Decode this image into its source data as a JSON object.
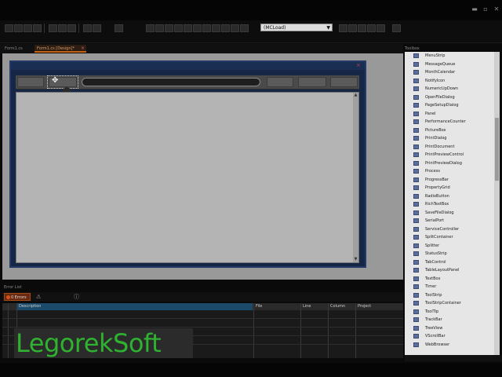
{
  "toolbar": {
    "config_combo": "(MCLoad)"
  },
  "doc_tabs": [
    {
      "label": "Form1.cs"
    },
    {
      "label": "Form1.cs [Design]*",
      "close": "×"
    }
  ],
  "form": {
    "close_glyph": "×",
    "move_glyph": "✥",
    "scroll_up": "▲",
    "scroll_down": "▼"
  },
  "error_list": {
    "header": "Error List",
    "errors_badge": "0 Errors",
    "columns": [
      "Description",
      "File",
      "Line",
      "Column",
      "Project"
    ]
  },
  "watermark": "LegorekSoft",
  "toolbox": {
    "title": "Toolbox",
    "items": [
      "MenuStrip",
      "MessageQueue",
      "MonthCalendar",
      "NotifyIcon",
      "NumericUpDown",
      "OpenFileDialog",
      "PageSetupDialog",
      "Panel",
      "PerformanceCounter",
      "PictureBox",
      "PrintDialog",
      "PrintDocument",
      "PrintPreviewControl",
      "PrintPreviewDialog",
      "Process",
      "ProgressBar",
      "PropertyGrid",
      "RadioButton",
      "RichTextBox",
      "SaveFileDialog",
      "SerialPort",
      "ServiceController",
      "SplitContainer",
      "Splitter",
      "StatusStrip",
      "TabControl",
      "TableLayoutPanel",
      "TextBox",
      "Timer",
      "ToolStrip",
      "ToolStripContainer",
      "ToolTip",
      "TrackBar",
      "TreeView",
      "VScrollBar",
      "WebBrowser"
    ]
  },
  "colors": {
    "accent_tab": "#c06010",
    "form_border": "#233a66",
    "watermark": "#2fb22f"
  }
}
